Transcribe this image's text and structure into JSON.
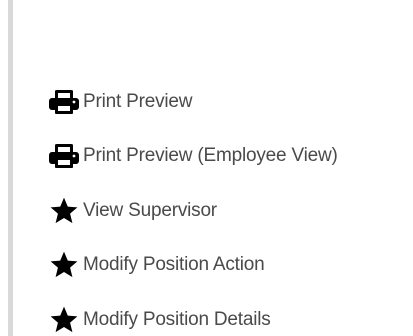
{
  "actions": {
    "items": [
      {
        "label": "Print Preview",
        "icon": "print-icon"
      },
      {
        "label": "Print Preview (Employee View)",
        "icon": "print-icon"
      },
      {
        "label": "View Supervisor",
        "icon": "star-icon"
      },
      {
        "label": "Modify Position Action",
        "icon": "star-icon"
      },
      {
        "label": "Modify Position Details",
        "icon": "star-icon"
      }
    ]
  },
  "colors": {
    "text": "#4a4a4a",
    "icon": "#000000",
    "rule": "#d9d9d9"
  }
}
